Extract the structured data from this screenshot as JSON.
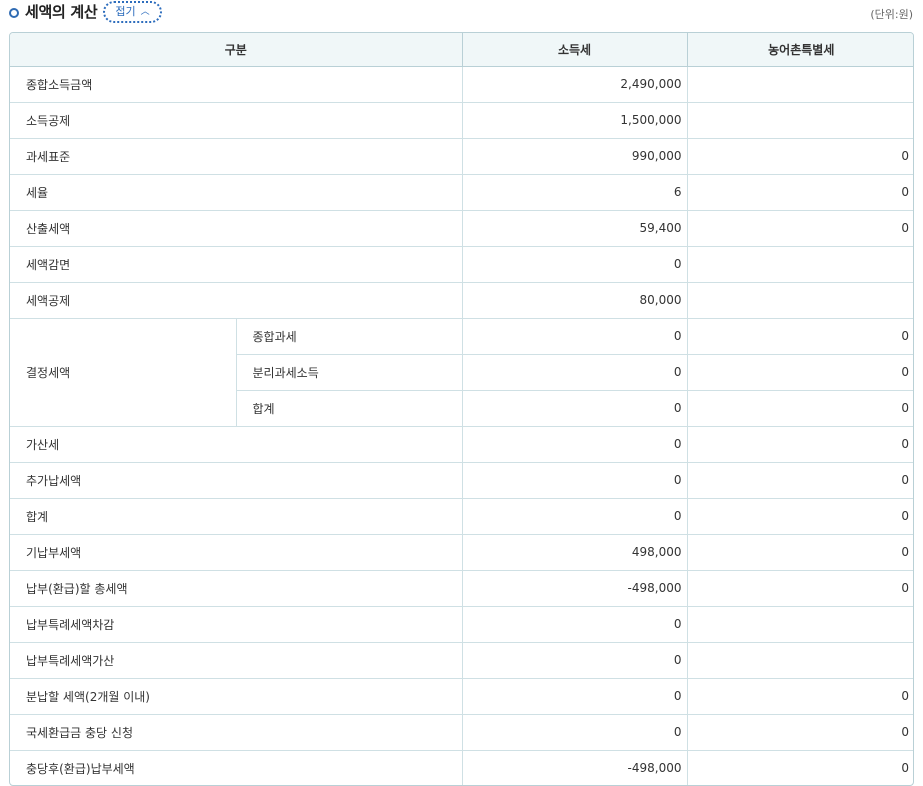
{
  "section": {
    "title": "세액의 계산",
    "fold_button": "접기",
    "unit": "(단위:원)"
  },
  "table": {
    "headers": [
      "구분",
      "소득세",
      "농어촌특별세"
    ],
    "rows": [
      {
        "label": "종합소득금액",
        "income": "2,490,000",
        "rural": ""
      },
      {
        "label": "소득공제",
        "income": "1,500,000",
        "rural": ""
      },
      {
        "label": "과세표준",
        "income": "990,000",
        "rural": "0"
      },
      {
        "label": "세율",
        "income": "6",
        "rural": "0"
      },
      {
        "label": "산출세액",
        "income": "59,400",
        "rural": "0"
      },
      {
        "label": "세액감면",
        "income": "0",
        "rural": ""
      },
      {
        "label": "세액공제",
        "income": "80,000",
        "rural": ""
      }
    ],
    "group": {
      "label": "결정세액",
      "sub_rows": [
        {
          "label": "종합과세",
          "income": "0",
          "rural": "0"
        },
        {
          "label": "분리과세소득",
          "income": "0",
          "rural": "0"
        },
        {
          "label": "합계",
          "income": "0",
          "rural": "0"
        }
      ]
    },
    "rows_after": [
      {
        "label": "가산세",
        "income": "0",
        "rural": "0"
      },
      {
        "label": "추가납세액",
        "income": "0",
        "rural": "0"
      },
      {
        "label": "합계",
        "income": "0",
        "rural": "0"
      },
      {
        "label": "기납부세액",
        "income": "498,000",
        "rural": "0"
      },
      {
        "label": "납부(환급)할 총세액",
        "income": "-498,000",
        "rural": "0"
      },
      {
        "label": "납부특례세액차감",
        "income": "0",
        "rural": ""
      },
      {
        "label": "납부특례세액가산",
        "income": "0",
        "rural": ""
      },
      {
        "label": "분납할 세액(2개월 이내)",
        "income": "0",
        "rural": "0"
      },
      {
        "label": "국세환급금 충당 신청",
        "income": "0",
        "rural": "0"
      },
      {
        "label": "충당후(환급)납부세액",
        "income": "-498,000",
        "rural": "0"
      }
    ]
  },
  "colors": {
    "accent": "#2d6dbd",
    "header_bg": "#f0f7f8",
    "border": "#b9d0d6"
  }
}
